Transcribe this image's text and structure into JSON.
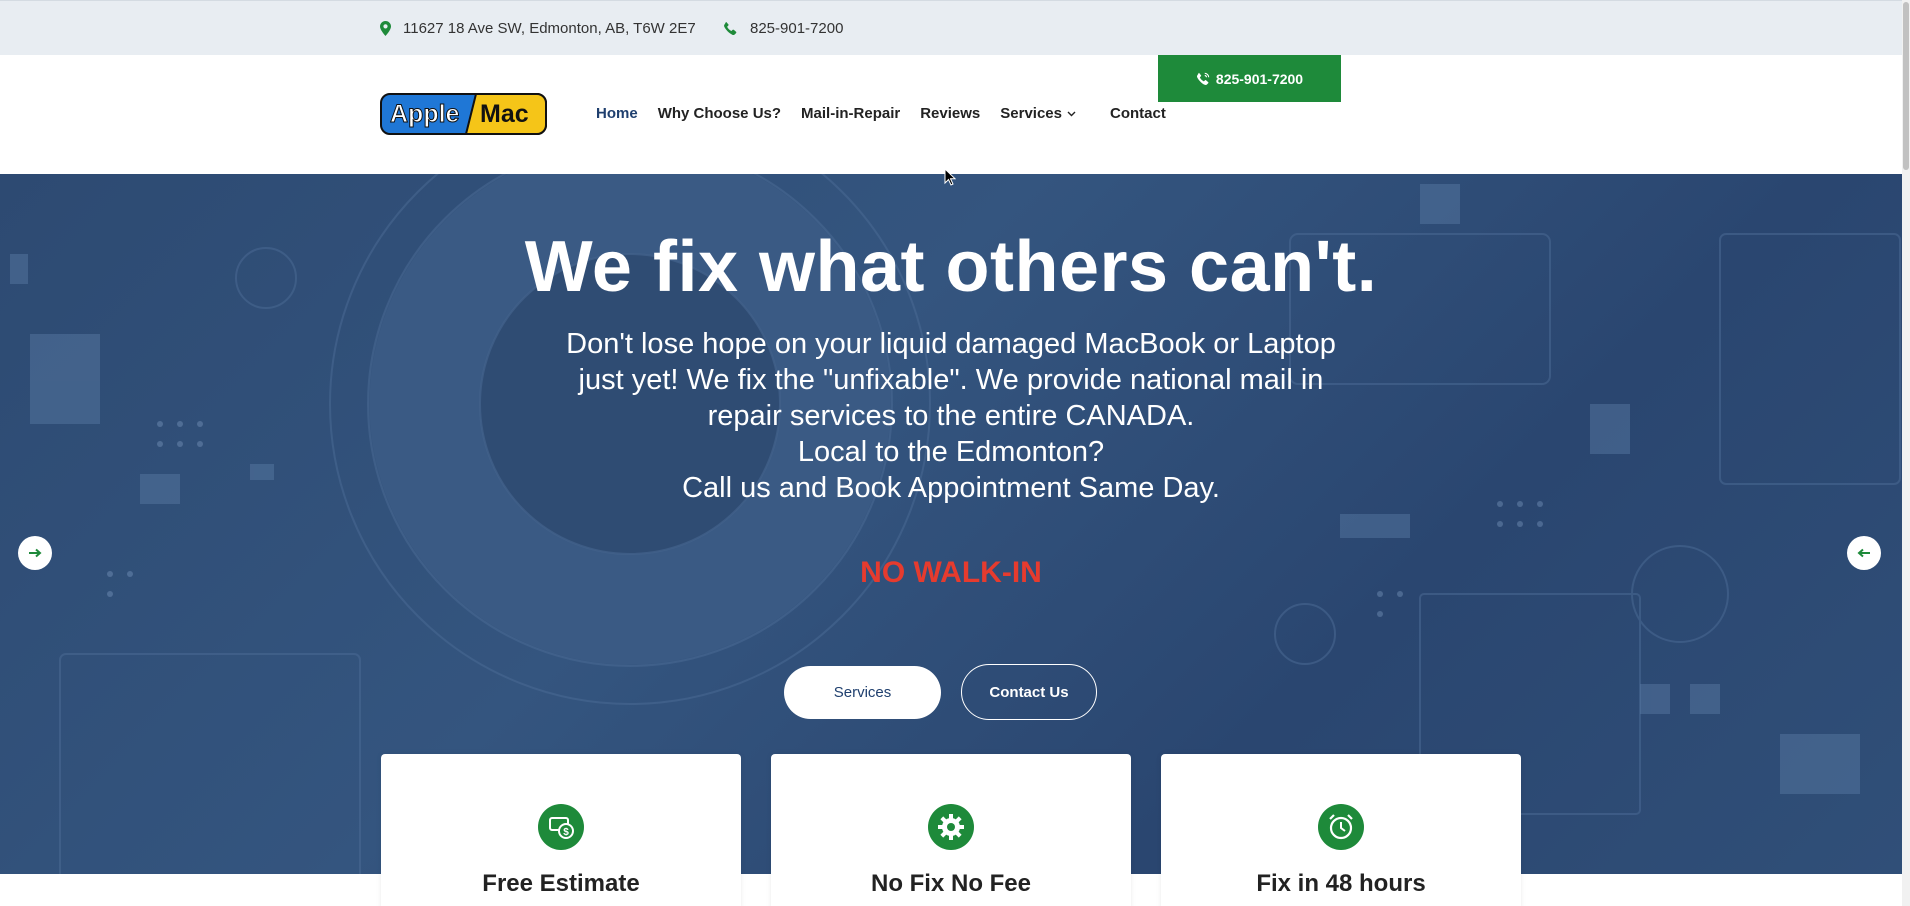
{
  "topbar": {
    "address": "11627 18 Ave SW, Edmonton, AB, T6W 2E7",
    "phone": "825-901-7200",
    "address_icon": "map-pin-icon",
    "phone_icon": "phone-icon"
  },
  "header": {
    "logo_part1": "Apple",
    "logo_part2": "Mac",
    "call_button": "825-901-7200",
    "nav": {
      "home": "Home",
      "why": "Why Choose Us?",
      "mail": "Mail-in-Repair",
      "reviews": "Reviews",
      "services": "Services",
      "contact": "Contact"
    }
  },
  "hero": {
    "title": "We fix what others can't.",
    "lines": [
      "Don't lose hope on your liquid damaged MacBook or Laptop",
      "just yet! We fix the \"unfixable\". We provide national mail in",
      "repair services to the entire CANADA.",
      "Local to the Edmonton?",
      "Call us and Book Appointment Same Day."
    ],
    "alert": "NO WALK-IN",
    "button_services": "Services",
    "button_contact": "Contact Us"
  },
  "features": [
    {
      "title": "Free Estimate",
      "icon": "money-icon"
    },
    {
      "title": "No Fix No Fee",
      "icon": "gear-icon"
    },
    {
      "title": "Fix in 48 hours",
      "icon": "alarm-clock-icon"
    }
  ],
  "colors": {
    "brand_green": "#1e8a3a",
    "brand_navy": "#1f3f6e",
    "hero_bg": "#2d4a72",
    "alert_red": "#e63b2e",
    "logo_blue": "#1f77d6",
    "logo_yellow": "#f5c518"
  }
}
